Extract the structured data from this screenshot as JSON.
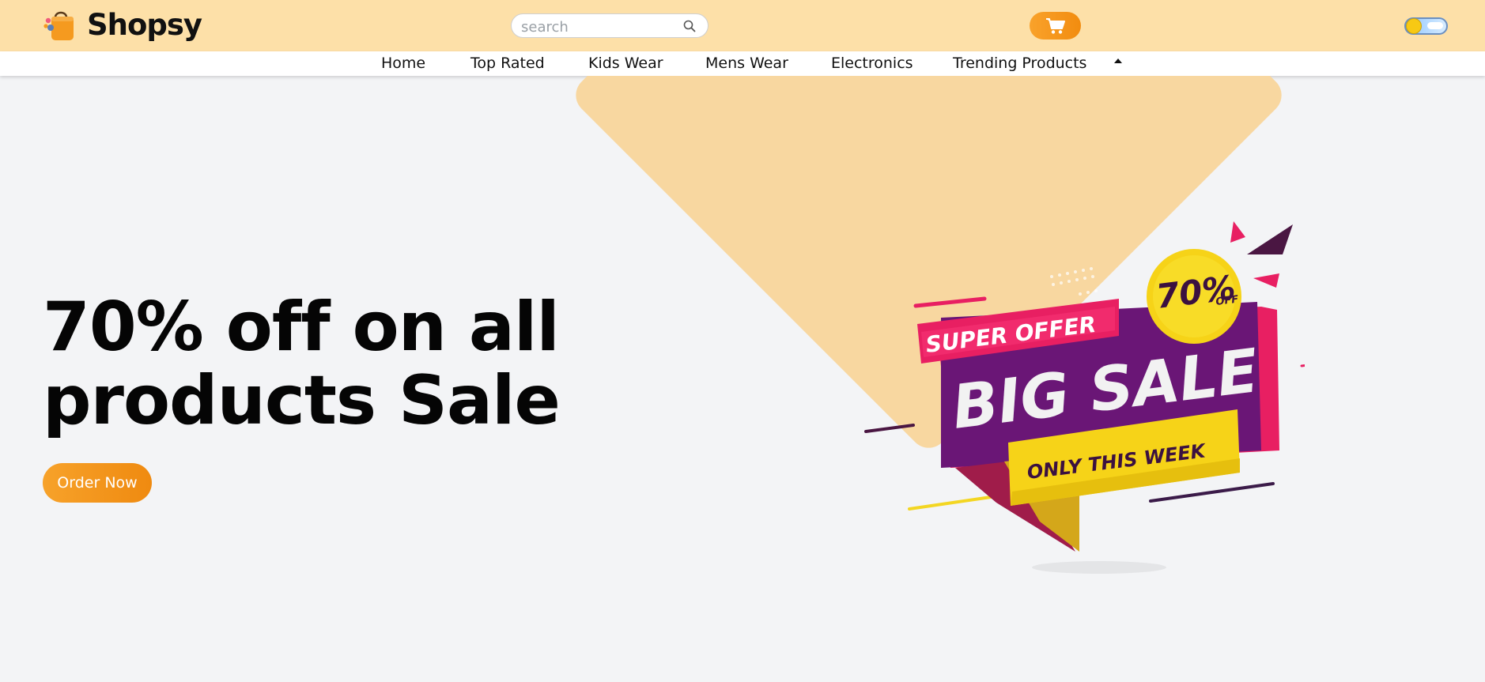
{
  "header": {
    "brand": "Shopsy",
    "search_placeholder": "search"
  },
  "nav": {
    "items": [
      "Home",
      "Top Rated",
      "Kids Wear",
      "Mens Wear",
      "Electronics",
      "Trending Products"
    ]
  },
  "hero": {
    "title_line1": "70% off on all",
    "title_line2": "products Sale",
    "cta_label": "Order Now"
  },
  "banner": {
    "super_offer": "SUPER OFFER",
    "big_sale": "BIG SALE",
    "only_this_week": "ONLY THIS WEEK",
    "discount": "70%",
    "discount_suffix": "OFF"
  },
  "icons": {
    "search": "search-icon",
    "cart": "cart-icon",
    "theme_toggle": "theme-toggle",
    "dropdown": "caret-up-icon"
  },
  "colors": {
    "header_bg": "#fde0a8",
    "accent": "#f59e1c",
    "hero_shape": "#f8d7a0",
    "page_bg": "#f3f4f6"
  }
}
